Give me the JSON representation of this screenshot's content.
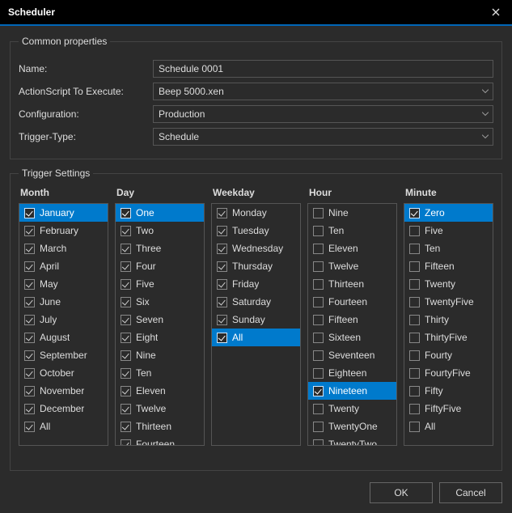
{
  "window": {
    "title": "Scheduler"
  },
  "common": {
    "legend": "Common properties",
    "name_label": "Name:",
    "name_value": "Schedule 0001",
    "action_label": "ActionScript To Execute:",
    "action_value": "Beep 5000.xen",
    "config_label": "Configuration:",
    "config_value": "Production",
    "trigger_type_label": "Trigger-Type:",
    "trigger_type_value": "Schedule"
  },
  "trigger": {
    "legend": "Trigger Settings",
    "columns": {
      "month": {
        "header": "Month",
        "items": [
          {
            "label": "January",
            "checked": true,
            "selected": true
          },
          {
            "label": "February",
            "checked": true,
            "selected": false
          },
          {
            "label": "March",
            "checked": true,
            "selected": false
          },
          {
            "label": "April",
            "checked": true,
            "selected": false
          },
          {
            "label": "May",
            "checked": true,
            "selected": false
          },
          {
            "label": "June",
            "checked": true,
            "selected": false
          },
          {
            "label": "July",
            "checked": true,
            "selected": false
          },
          {
            "label": "August",
            "checked": true,
            "selected": false
          },
          {
            "label": "September",
            "checked": true,
            "selected": false
          },
          {
            "label": "October",
            "checked": true,
            "selected": false
          },
          {
            "label": "November",
            "checked": true,
            "selected": false
          },
          {
            "label": "December",
            "checked": true,
            "selected": false
          },
          {
            "label": "All",
            "checked": true,
            "selected": false
          }
        ]
      },
      "day": {
        "header": "Day",
        "items": [
          {
            "label": "One",
            "checked": true,
            "selected": true
          },
          {
            "label": "Two",
            "checked": true,
            "selected": false
          },
          {
            "label": "Three",
            "checked": true,
            "selected": false
          },
          {
            "label": "Four",
            "checked": true,
            "selected": false
          },
          {
            "label": "Five",
            "checked": true,
            "selected": false
          },
          {
            "label": "Six",
            "checked": true,
            "selected": false
          },
          {
            "label": "Seven",
            "checked": true,
            "selected": false
          },
          {
            "label": "Eight",
            "checked": true,
            "selected": false
          },
          {
            "label": "Nine",
            "checked": true,
            "selected": false
          },
          {
            "label": "Ten",
            "checked": true,
            "selected": false
          },
          {
            "label": "Eleven",
            "checked": true,
            "selected": false
          },
          {
            "label": "Twelve",
            "checked": true,
            "selected": false
          },
          {
            "label": "Thirteen",
            "checked": true,
            "selected": false
          },
          {
            "label": "Fourteen",
            "checked": true,
            "selected": false
          }
        ]
      },
      "weekday": {
        "header": "Weekday",
        "items": [
          {
            "label": "Monday",
            "checked": true,
            "selected": false
          },
          {
            "label": "Tuesday",
            "checked": true,
            "selected": false
          },
          {
            "label": "Wednesday",
            "checked": true,
            "selected": false
          },
          {
            "label": "Thursday",
            "checked": true,
            "selected": false
          },
          {
            "label": "Friday",
            "checked": true,
            "selected": false
          },
          {
            "label": "Saturday",
            "checked": true,
            "selected": false
          },
          {
            "label": "Sunday",
            "checked": true,
            "selected": false
          },
          {
            "label": "All",
            "checked": true,
            "selected": true
          }
        ]
      },
      "hour": {
        "header": "Hour",
        "items": [
          {
            "label": "Nine",
            "checked": false,
            "selected": false
          },
          {
            "label": "Ten",
            "checked": false,
            "selected": false
          },
          {
            "label": "Eleven",
            "checked": false,
            "selected": false
          },
          {
            "label": "Twelve",
            "checked": false,
            "selected": false
          },
          {
            "label": "Thirteen",
            "checked": false,
            "selected": false
          },
          {
            "label": "Fourteen",
            "checked": false,
            "selected": false
          },
          {
            "label": "Fifteen",
            "checked": false,
            "selected": false
          },
          {
            "label": "Sixteen",
            "checked": false,
            "selected": false
          },
          {
            "label": "Seventeen",
            "checked": false,
            "selected": false
          },
          {
            "label": "Eighteen",
            "checked": false,
            "selected": false
          },
          {
            "label": "Nineteen",
            "checked": true,
            "selected": true
          },
          {
            "label": "Twenty",
            "checked": false,
            "selected": false
          },
          {
            "label": "TwentyOne",
            "checked": false,
            "selected": false
          },
          {
            "label": "TwentyTwo",
            "checked": false,
            "selected": false
          }
        ]
      },
      "minute": {
        "header": "Minute",
        "items": [
          {
            "label": "Zero",
            "checked": true,
            "selected": true
          },
          {
            "label": "Five",
            "checked": false,
            "selected": false
          },
          {
            "label": "Ten",
            "checked": false,
            "selected": false
          },
          {
            "label": "Fifteen",
            "checked": false,
            "selected": false
          },
          {
            "label": "Twenty",
            "checked": false,
            "selected": false
          },
          {
            "label": "TwentyFive",
            "checked": false,
            "selected": false
          },
          {
            "label": "Thirty",
            "checked": false,
            "selected": false
          },
          {
            "label": "ThirtyFive",
            "checked": false,
            "selected": false
          },
          {
            "label": "Fourty",
            "checked": false,
            "selected": false
          },
          {
            "label": "FourtyFive",
            "checked": false,
            "selected": false
          },
          {
            "label": "Fifty",
            "checked": false,
            "selected": false
          },
          {
            "label": "FiftyFive",
            "checked": false,
            "selected": false
          },
          {
            "label": "All",
            "checked": false,
            "selected": false
          }
        ]
      }
    }
  },
  "buttons": {
    "ok": "OK",
    "cancel": "Cancel"
  }
}
